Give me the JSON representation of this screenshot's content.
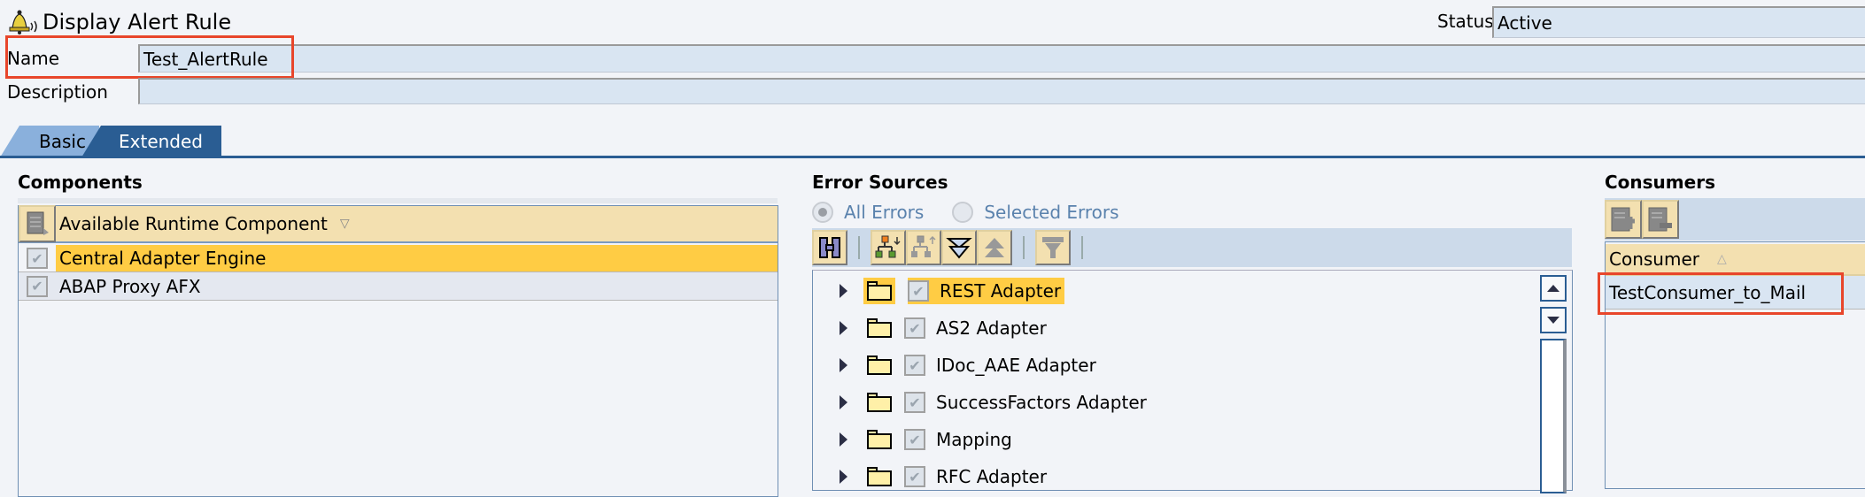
{
  "header": {
    "title": "Display Alert Rule",
    "title_icon": "alert-bell-icon",
    "name_label": "Name",
    "name_value": "Test_AlertRule",
    "description_label": "Description",
    "description_value": "",
    "status_label": "Status",
    "status_value": "Active"
  },
  "tabs": [
    {
      "label": "Basic",
      "active": false
    },
    {
      "label": "Extended",
      "active": true
    }
  ],
  "components": {
    "heading": "Components",
    "column_header": "Available Runtime Component",
    "sort_icon": "sort-descending-icon",
    "select_all_icon": "select-all-icon",
    "rows": [
      {
        "label": "Central Adapter Engine",
        "checked": true,
        "selected": true
      },
      {
        "label": "ABAP Proxy AFX",
        "checked": true,
        "selected": false
      }
    ]
  },
  "error_sources": {
    "heading": "Error Sources",
    "radio_all": "All Errors",
    "radio_selected": "Selected Errors",
    "selected_radio": "All Errors",
    "toolbar": [
      "find-icon",
      "expand-subtree-icon",
      "collapse-subtree-icon",
      "expand-all-icon",
      "collapse-all-icon",
      "filter-icon"
    ],
    "tree": [
      {
        "label": "REST Adapter",
        "checked": true,
        "selected": true
      },
      {
        "label": "AS2 Adapter",
        "checked": true,
        "selected": false
      },
      {
        "label": "IDoc_AAE Adapter",
        "checked": true,
        "selected": false
      },
      {
        "label": "SuccessFactors Adapter",
        "checked": true,
        "selected": false
      },
      {
        "label": "Mapping",
        "checked": true,
        "selected": false
      },
      {
        "label": "RFC Adapter",
        "checked": true,
        "selected": false
      }
    ]
  },
  "consumers": {
    "heading": "Consumers",
    "toolbar": [
      "add-row-icon",
      "remove-row-icon"
    ],
    "column_header": "Consumer",
    "sort_icon": "sort-ascending-icon",
    "rows": [
      "TestConsumer_to_Mail"
    ]
  },
  "colors": {
    "accent": "#2a5d93",
    "selection": "#ffcc44",
    "table_header": "#f3e0b0",
    "field_bg": "#d9e5f2",
    "highlight_box": "#e8462b"
  }
}
